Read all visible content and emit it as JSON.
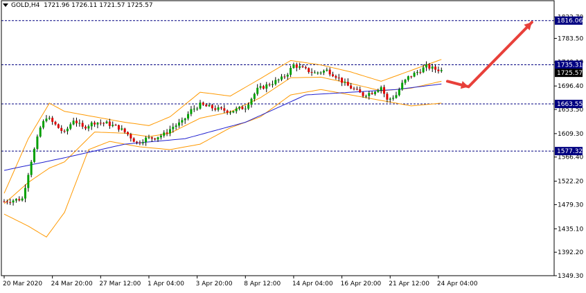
{
  "header": {
    "symbol": "GOLD,H4",
    "ohlc": "1721.96 1726.11 1721.57 1725.57"
  },
  "colors": {
    "bull": "#00a000",
    "bear": "#e00000",
    "wick": "#000000",
    "ma": "#1f1fcf",
    "bands": "#ff9900",
    "hline": "#000080",
    "price_tag_bg": "#000080",
    "arrow": "#e8403a",
    "grid_border": "#000000"
  },
  "chart_data": {
    "type": "candlestick",
    "title": "GOLD,H4",
    "y_range": [
      1349.3,
      1836.0
    ],
    "y_ticks": [
      "1822.70",
      "1783.50",
      "1740.10",
      "1696.40",
      "1653.50",
      "1609.30",
      "1566.40",
      "1522.20",
      "1479.30",
      "1435.10",
      "1392.20",
      "1349.30"
    ],
    "x_labels": [
      "20 Mar 2020",
      "24 Mar 20:00",
      "27 Mar 12:00",
      "1 Apr 04:00",
      "3 Apr 20:00",
      "8 Apr 12:00",
      "14 Apr 04:00",
      "16 Apr 20:00",
      "21 Apr 12:00",
      "24 Apr 04:00"
    ],
    "horizontal_levels": [
      {
        "label": "1816.06",
        "value": 1816.06
      },
      {
        "label": "1735.31",
        "value": 1735.31
      },
      {
        "label": "1663.55",
        "value": 1663.55
      },
      {
        "label": "1577.32",
        "value": 1577.32
      }
    ],
    "current_price": {
      "label": "1725.57",
      "value": 1725.57
    },
    "close_anchors": [
      [
        0,
        1485
      ],
      [
        6,
        1490
      ],
      [
        9,
        1560
      ],
      [
        12,
        1620
      ],
      [
        14,
        1640
      ],
      [
        17,
        1625
      ],
      [
        20,
        1610
      ],
      [
        23,
        1635
      ],
      [
        26,
        1620
      ],
      [
        30,
        1630
      ],
      [
        34,
        1628
      ],
      [
        38,
        1620
      ],
      [
        41,
        1608
      ],
      [
        44,
        1592
      ],
      [
        47,
        1600
      ],
      [
        50,
        1602
      ],
      [
        53,
        1608
      ],
      [
        56,
        1622
      ],
      [
        59,
        1630
      ],
      [
        62,
        1652
      ],
      [
        65,
        1662
      ],
      [
        70,
        1655
      ],
      [
        75,
        1650
      ],
      [
        80,
        1658
      ],
      [
        84,
        1690
      ],
      [
        88,
        1700
      ],
      [
        92,
        1710
      ],
      [
        94,
        1720
      ],
      [
        96,
        1735
      ],
      [
        99,
        1728
      ],
      [
        103,
        1720
      ],
      [
        107,
        1725
      ],
      [
        110,
        1715
      ],
      [
        113,
        1700
      ],
      [
        116,
        1690
      ],
      [
        119,
        1680
      ],
      [
        122,
        1685
      ],
      [
        125,
        1695
      ],
      [
        127,
        1670
      ],
      [
        130,
        1680
      ],
      [
        132,
        1700
      ],
      [
        134,
        1712
      ],
      [
        137,
        1722
      ],
      [
        140,
        1732
      ],
      [
        143,
        1727
      ],
      [
        145,
        1725.57
      ]
    ],
    "moving_average": [
      [
        0,
        1542
      ],
      [
        20,
        1565
      ],
      [
        40,
        1590
      ],
      [
        60,
        1600
      ],
      [
        80,
        1630
      ],
      [
        100,
        1680
      ],
      [
        115,
        1685
      ],
      [
        130,
        1690
      ],
      [
        145,
        1700
      ]
    ],
    "band_upper": [
      [
        0,
        1500
      ],
      [
        8,
        1600
      ],
      [
        15,
        1665
      ],
      [
        20,
        1650
      ],
      [
        30,
        1640
      ],
      [
        40,
        1630
      ],
      [
        48,
        1624
      ],
      [
        55,
        1640
      ],
      [
        65,
        1685
      ],
      [
        75,
        1678
      ],
      [
        85,
        1710
      ],
      [
        95,
        1743
      ],
      [
        105,
        1735
      ],
      [
        115,
        1722
      ],
      [
        125,
        1705
      ],
      [
        135,
        1725
      ],
      [
        145,
        1745
      ]
    ],
    "band_lower": [
      [
        0,
        1462
      ],
      [
        8,
        1440
      ],
      [
        14,
        1420
      ],
      [
        20,
        1465
      ],
      [
        28,
        1580
      ],
      [
        35,
        1595
      ],
      [
        45,
        1585
      ],
      [
        55,
        1580
      ],
      [
        65,
        1590
      ],
      [
        75,
        1620
      ],
      [
        85,
        1640
      ],
      [
        95,
        1680
      ],
      [
        105,
        1690
      ],
      [
        115,
        1680
      ],
      [
        125,
        1670
      ],
      [
        135,
        1660
      ],
      [
        145,
        1665
      ]
    ],
    "arrow_points": [
      [
        147,
        1705
      ],
      [
        154,
        1695
      ],
      [
        175,
        1813
      ]
    ]
  }
}
